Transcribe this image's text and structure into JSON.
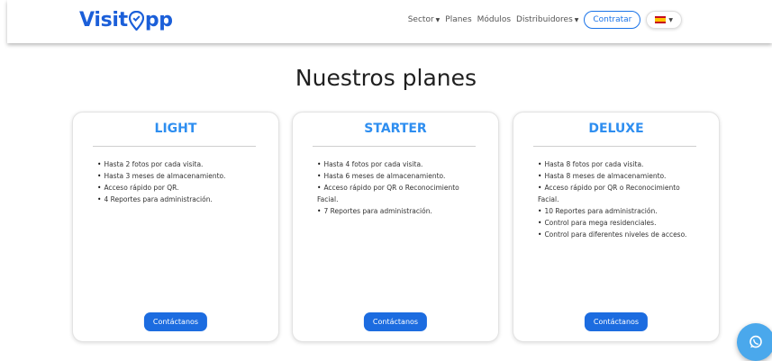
{
  "header": {
    "logo": {
      "part1": "Visit",
      "part2": "pp"
    },
    "nav": {
      "sector": "Sector",
      "planes": "Planes",
      "modulos": "Módulos",
      "distribuidores": "Distribuidores",
      "contratar": "Contratar"
    },
    "language_flag": "spain-flag-icon"
  },
  "page": {
    "title": "Nuestros planes"
  },
  "plans": [
    {
      "name": "LIGHT",
      "features": [
        "Hasta 2 fotos por cada visita.",
        "Hasta 3 meses de almacenamiento.",
        "Acceso rápido por QR.",
        "4 Reportes para administración."
      ],
      "button": "Contáctanos"
    },
    {
      "name": "STARTER",
      "features": [
        "Hasta 4 fotos por cada visita.",
        "Hasta 6 meses de almacenamiento.",
        "Acceso rápido por QR o Reconocimiento Facial.",
        "7 Reportes para administración."
      ],
      "button": "Contáctanos"
    },
    {
      "name": "DELUXE",
      "features": [
        "Hasta 8 fotos por cada visita.",
        "Hasta 8 meses de almacenamiento.",
        "Acceso rápido por QR o Reconocimiento Facial.",
        "10 Reportes para administración.",
        "Control para mega residenciales.",
        "Control para diferentes niveles de acceso."
      ],
      "button": "Contáctanos"
    }
  ],
  "colors": {
    "brand": "#1b5fd9",
    "accent": "#2e8ef0",
    "button": "#1c6ce0",
    "chat": "#4aa8ec"
  }
}
